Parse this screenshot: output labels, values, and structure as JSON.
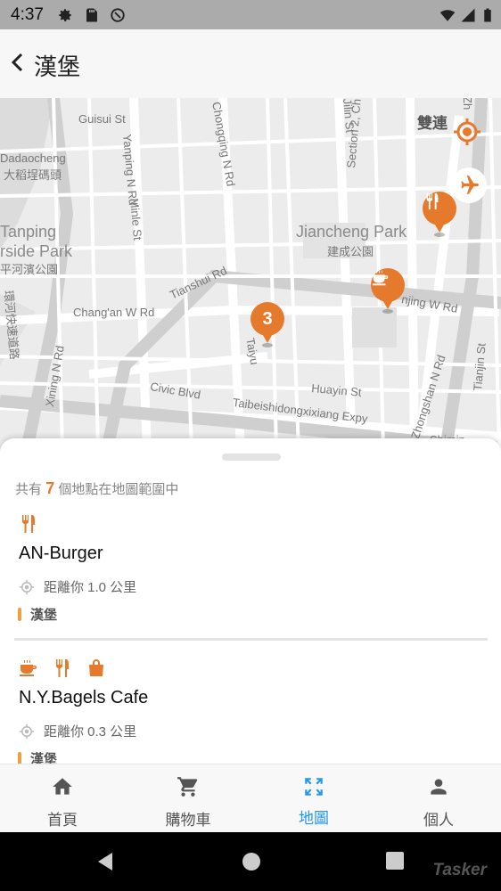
{
  "status_bar": {
    "time": "4:37"
  },
  "header": {
    "title": "漢堡"
  },
  "map": {
    "labels": {
      "guisui": "Guisui St",
      "yanping": "Yanping N Rd",
      "chongqing": "Chongqing N Rd",
      "yanping_n_rd_top": "",
      "section2": "Section 2, Ch",
      "jilin": "Jilin St",
      "zh": "Zh",
      "shuanglian": "雙連",
      "dadaocheng1": "Dadaocheng",
      "dadaocheng2": "大稻埕碼頭",
      "yanping_park1": "Tanping",
      "yanping_park2": "rside Park",
      "yanping_park3": "平河濱公園",
      "minle": "Minle St",
      "jiancheng": "Jiancheng Park",
      "jiancheng_cn": "建成公園",
      "tianshui": "Tianshui Rd",
      "changan": "Chang'an W Rd",
      "nanjing": "njing W Rd",
      "huanhe": "環河快速道路",
      "xining": "Xining N Rd",
      "taiyuan": "Taiyu",
      "civic": "Civic Blvd",
      "huayin": "Huayin St",
      "zhongshan": "Zhongshan N Rd",
      "tianjin": "Tianjin St",
      "taipei_expy": "Taibeishidongxixiang Expy",
      "shimin": "Shimin"
    },
    "cluster_count": "3"
  },
  "sheet": {
    "summary_prefix": "共有",
    "summary_count": "7",
    "summary_suffix": "個地點在地圖範圍中",
    "places": [
      {
        "name": "AN-Burger",
        "distance": "距離你 1.0 公里",
        "tag": "漢堡",
        "icons": [
          "fork-knife-icon"
        ]
      },
      {
        "name": "N.Y.Bagels Cafe",
        "distance": "距離你 0.3 公里",
        "tag": "漢堡",
        "icons": [
          "coffee-cup-icon",
          "fork-knife-icon",
          "shopping-bag-icon"
        ]
      }
    ]
  },
  "bottom_nav": {
    "items": [
      {
        "label": "首頁",
        "icon": "home-icon"
      },
      {
        "label": "購物車",
        "icon": "cart-icon"
      },
      {
        "label": "地圖",
        "icon": "map-expand-icon",
        "active": true
      },
      {
        "label": "個人",
        "icon": "person-icon"
      }
    ]
  },
  "watermark": "Tasker",
  "colors": {
    "accent": "#e57a2c",
    "active_nav": "#2196f3"
  }
}
